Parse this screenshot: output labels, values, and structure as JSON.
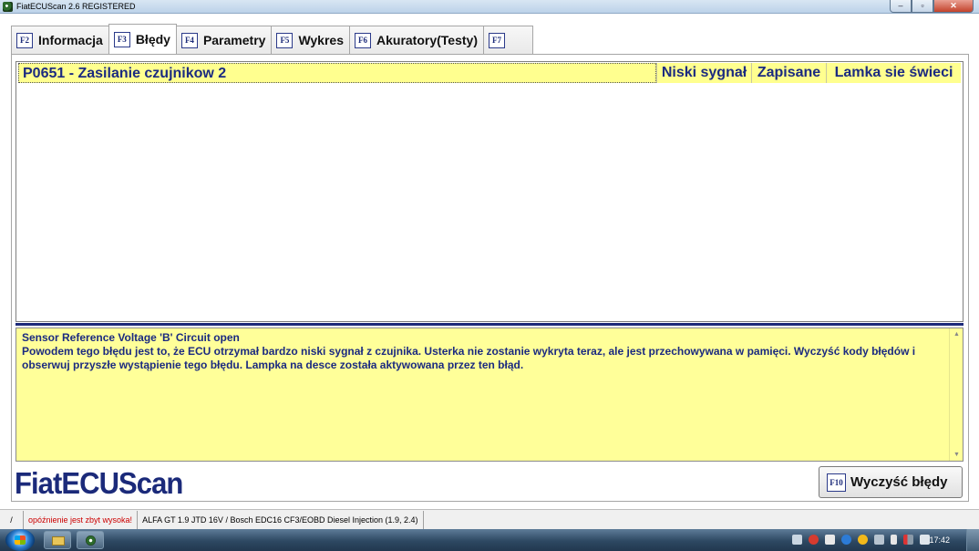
{
  "window": {
    "title": "FiatECUScan 2.6 REGISTERED",
    "controls": {
      "minimize": "–",
      "maximize": "▫",
      "close": "✕"
    }
  },
  "tabs": [
    {
      "key": "F2",
      "label": "Informacja",
      "active": false
    },
    {
      "key": "F3",
      "label": "Błędy",
      "active": true
    },
    {
      "key": "F4",
      "label": "Parametry",
      "active": false
    },
    {
      "key": "F5",
      "label": "Wykres",
      "active": false
    },
    {
      "key": "F6",
      "label": "Akuratory(Testy)",
      "active": false
    },
    {
      "key": "F7",
      "label": "",
      "active": false
    }
  ],
  "faults": [
    {
      "code": "P0651 - Zasilanie czujnikow 2",
      "signal": "Niski sygnał",
      "state": "Zapisane",
      "lamp": "Lamka sie świeci"
    }
  ],
  "description": {
    "title": "Sensor Reference Voltage 'B' Circuit open",
    "body": "Powodem tego błędu jest to, że ECU otrzymał bardzo niski sygnał z czujnika. Usterka nie zostanie wykryta teraz, ale jest przechowywana w pamięci. Wyczyść kody błędów i obserwuj przyszłe wystąpienie tego błędu. Lampka na desce została aktywowana przez ten błąd."
  },
  "logo": "FiatECUScan",
  "clear_button": {
    "key": "F10",
    "label": "Wyczyść błędy"
  },
  "statusbar": {
    "slot1": "/",
    "warning": "opóźnienie jest zbyt wysoka!",
    "vehicle": "ALFA GT 1.9 JTD 16V / Bosch EDC16 CF3/EOBD Diesel Injection (1.9, 2.4)"
  },
  "taskbar": {
    "clock": "17:42"
  },
  "colors": {
    "accent": "#1b2a80",
    "fault_row": "#ffff8f",
    "description_bg": "#ffff99",
    "warning": "#cc0000"
  }
}
